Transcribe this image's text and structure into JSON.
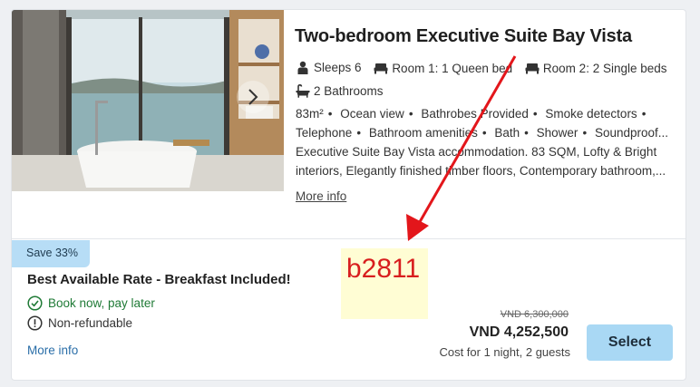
{
  "room": {
    "title": "Two-bedroom Executive Suite Bay Vista",
    "specs": [
      {
        "icon": "person-icon",
        "label": "Sleeps 6"
      },
      {
        "icon": "bed-icon",
        "label": "Room 1: 1 Queen bed"
      },
      {
        "icon": "bed-icon",
        "label": "Room 2: 2 Single beds"
      },
      {
        "icon": "bathtub-icon",
        "label": "2 Bathrooms"
      }
    ],
    "amenities": [
      "83m²",
      "Ocean view",
      "Bathrobes Provided",
      "Smoke detectors",
      "Telephone",
      "Bathroom amenities",
      "Bath",
      "Shower",
      "Soundproof..."
    ],
    "description": "Executive Suite Bay Vista accommodation. 83 SQM, Lofty & Bright interiors, Elegantly finished timber floors, Contemporary bathroom,...",
    "more_info": "More info"
  },
  "rate": {
    "badge": "Save 33%",
    "title": "Best Available Rate - Breakfast Included!",
    "perks": [
      {
        "icon": "check-circle-icon",
        "label": "Book now, pay later"
      },
      {
        "icon": "alert-circle-icon",
        "label": "Non-refundable"
      }
    ],
    "more_info": "More info",
    "old_price": "VND 6,300,000",
    "price": "VND 4,252,500",
    "cost_note": "Cost for 1 night, 2 guests",
    "select_label": "Select"
  },
  "annotation": {
    "marker_text": "b2811",
    "arrow_color": "#e3161b"
  }
}
